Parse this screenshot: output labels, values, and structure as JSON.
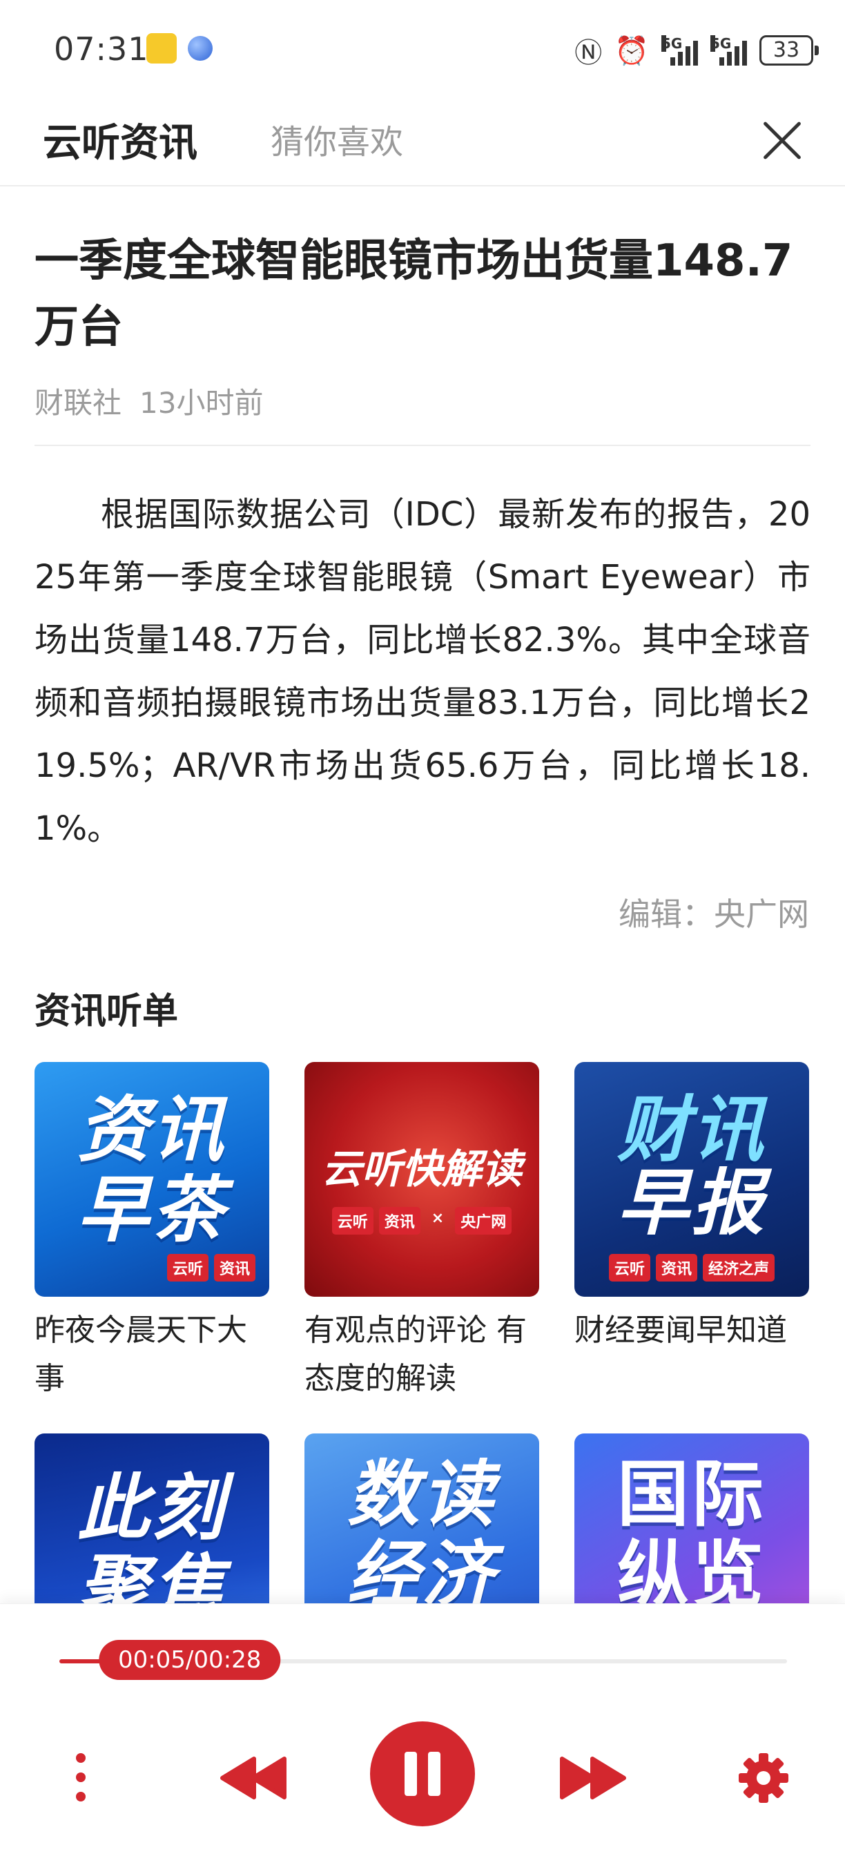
{
  "status_bar": {
    "time": "07:31",
    "network_1": "5G",
    "network_2": "5G",
    "battery": "33"
  },
  "header": {
    "tab_active": "云听资讯",
    "tab_inactive": "猜你喜欢"
  },
  "article": {
    "title": "一季度全球智能眼镜市场出货量148.7万台",
    "source": "财联社",
    "time_ago": "13小时前",
    "body": "根据国际数据公司（IDC）最新发布的报告，2025年第一季度全球智能眼镜（Smart Eyewear）市场出货量148.7万台，同比增长82.3%。其中全球音频和音频拍摄眼镜市场出货量83.1万台，同比增长219.5%；AR/VR市场出货65.6万台，同比增长18.1%。",
    "editor": "编辑：央广网"
  },
  "playlist": {
    "title": "资讯听单",
    "items": [
      {
        "thumb_line1": "资讯",
        "thumb_line2": "早茶",
        "badges": [
          "云听",
          "资讯"
        ],
        "desc": "昨夜今晨天下大事"
      },
      {
        "thumb_line1": "云听快解读",
        "badges": [
          "云听",
          "资讯",
          "×",
          "央广网"
        ],
        "desc": "有观点的评论 有态度的解读"
      },
      {
        "thumb_line1": "财讯",
        "thumb_line2": "早报",
        "badges": [
          "云听",
          "资讯",
          "经济之声"
        ],
        "desc": "财经要闻早知道"
      },
      {
        "thumb_line1": "此刻",
        "thumb_line2": "聚焦"
      },
      {
        "thumb_line1": "数读",
        "thumb_line2": "经济"
      },
      {
        "thumb_line1": "国际",
        "thumb_line2": "纵览"
      }
    ]
  },
  "player": {
    "time_display": "00:05/00:28",
    "progress_fraction": 0.179,
    "accent_color": "#d3272e",
    "icons": [
      "more-vertical-icon",
      "rewind-icon",
      "pause-icon",
      "fast-forward-icon",
      "gear-icon"
    ]
  }
}
